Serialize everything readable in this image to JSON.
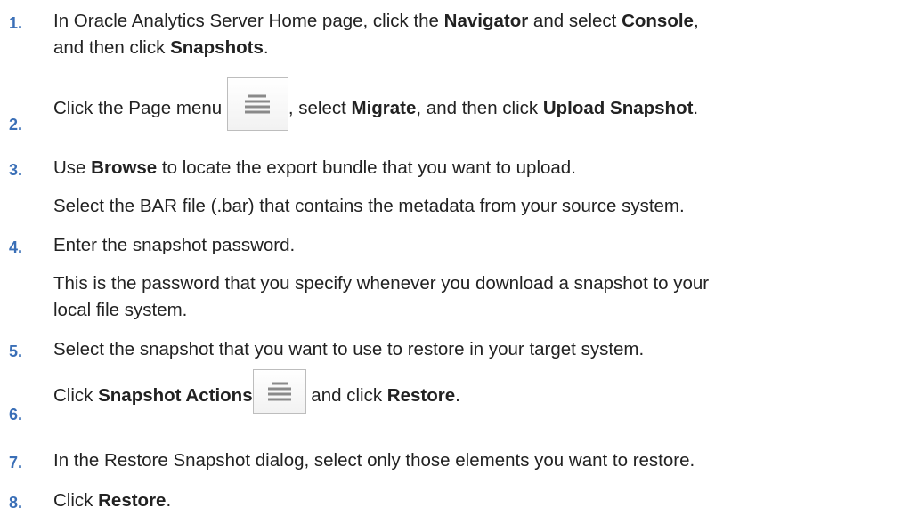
{
  "steps": [
    {
      "number": "1.",
      "line1": {
        "t1": "In Oracle Analytics Server Home page, click the ",
        "b1": "Navigator",
        "t2": " and select ",
        "b2": "Console",
        "t3": ","
      },
      "line2": {
        "t1": "and then click ",
        "b1": "Snapshots",
        "t2": "."
      }
    },
    {
      "number": "2.",
      "t1": "Click the Page menu ",
      "icon": "hamburger-menu-icon",
      "t2": ", select ",
      "b1": "Migrate",
      "t3": ", and then click ",
      "b2": "Upload Snapshot",
      "t4": "."
    },
    {
      "number": "3.",
      "t1": "Use ",
      "b1": "Browse",
      "t2": " to locate the export bundle that you want to upload.",
      "detail": "Select the BAR file (.bar) that contains the metadata from your source system."
    },
    {
      "number": "4.",
      "text": "Enter the snapshot password.",
      "detail_line1": "This is the password that you specify whenever you download a snapshot to your",
      "detail_line2": "local file system."
    },
    {
      "number": "5.",
      "text": "Select the snapshot that you want to use to restore in your target system."
    },
    {
      "number": "6.",
      "t1": "Click ",
      "b1": "Snapshot Actions",
      "icon": "hamburger-menu-icon",
      "t2": " and click ",
      "b2": "Restore",
      "t3": "."
    },
    {
      "number": "7.",
      "text": "In the Restore Snapshot dialog, select only those elements you want to restore."
    },
    {
      "number": "8.",
      "t1": "Click ",
      "b1": "Restore",
      "t2": "."
    }
  ]
}
